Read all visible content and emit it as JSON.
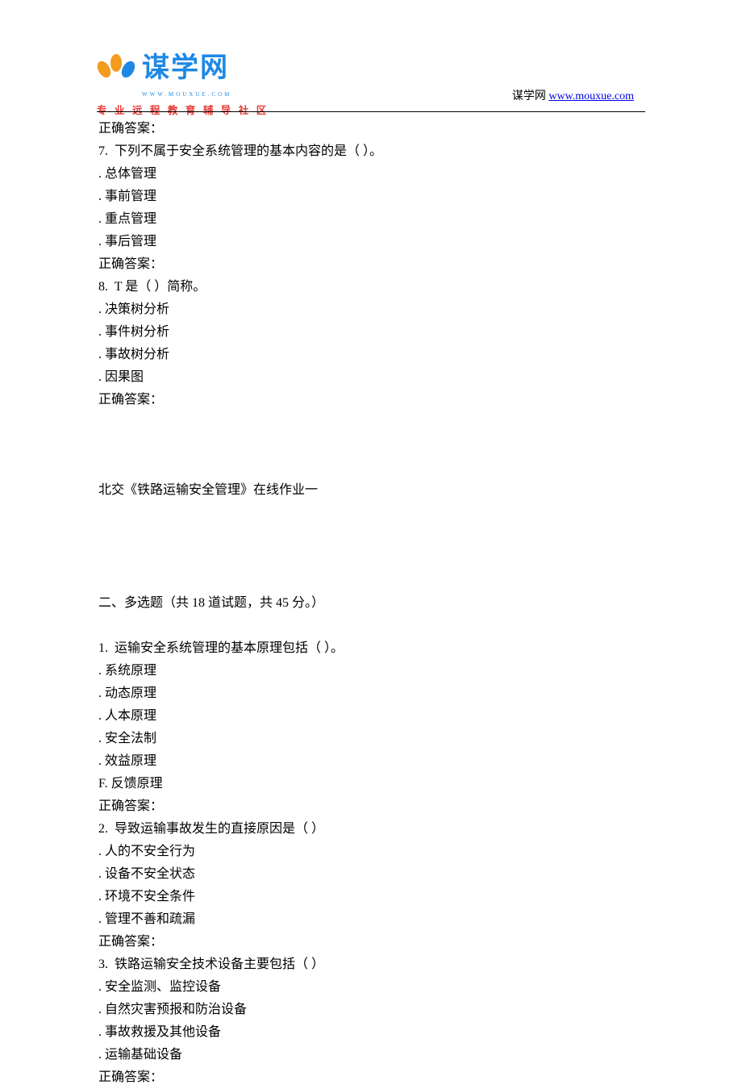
{
  "header": {
    "brand": "谋学网",
    "brand_sub": "WWW.MOUXUE.COM",
    "tagline": "专 业 远 程 教 育 辅 导 社 区",
    "right_text": "谋学网 ",
    "right_link": "www.mouxue.com"
  },
  "lines": [
    "正确答案：",
    "7.  下列不属于安全系统管理的基本内容的是（ ）。",
    ". 总体管理",
    ". 事前管理",
    ". 重点管理",
    ". 事后管理",
    "正确答案：",
    "8.  T 是（ ）简称。",
    ". 决策树分析",
    ". 事件树分析",
    ". 事故树分析",
    ". 因果图",
    "正确答案：",
    "",
    "",
    "",
    "北交《铁路运输安全管理》在线作业一",
    "",
    "",
    "",
    "",
    "二、多选题（共 18 道试题，共 45 分。）",
    "",
    "1.  运输安全系统管理的基本原理包括（ ）。",
    ". 系统原理",
    ". 动态原理",
    ". 人本原理",
    ". 安全法制",
    ". 效益原理",
    "F. 反馈原理",
    "正确答案：",
    "2.  导致运输事故发生的直接原因是（ ）",
    ". 人的不安全行为",
    ". 设备不安全状态",
    ". 环境不安全条件",
    ". 管理不善和疏漏",
    "正确答案：",
    "3.  铁路运输安全技术设备主要包括（ ）",
    ". 安全监测、监控设备",
    ". 自然灾害预报和防治设备",
    ". 事故救援及其他设备",
    ". 运输基础设备",
    "正确答案："
  ]
}
